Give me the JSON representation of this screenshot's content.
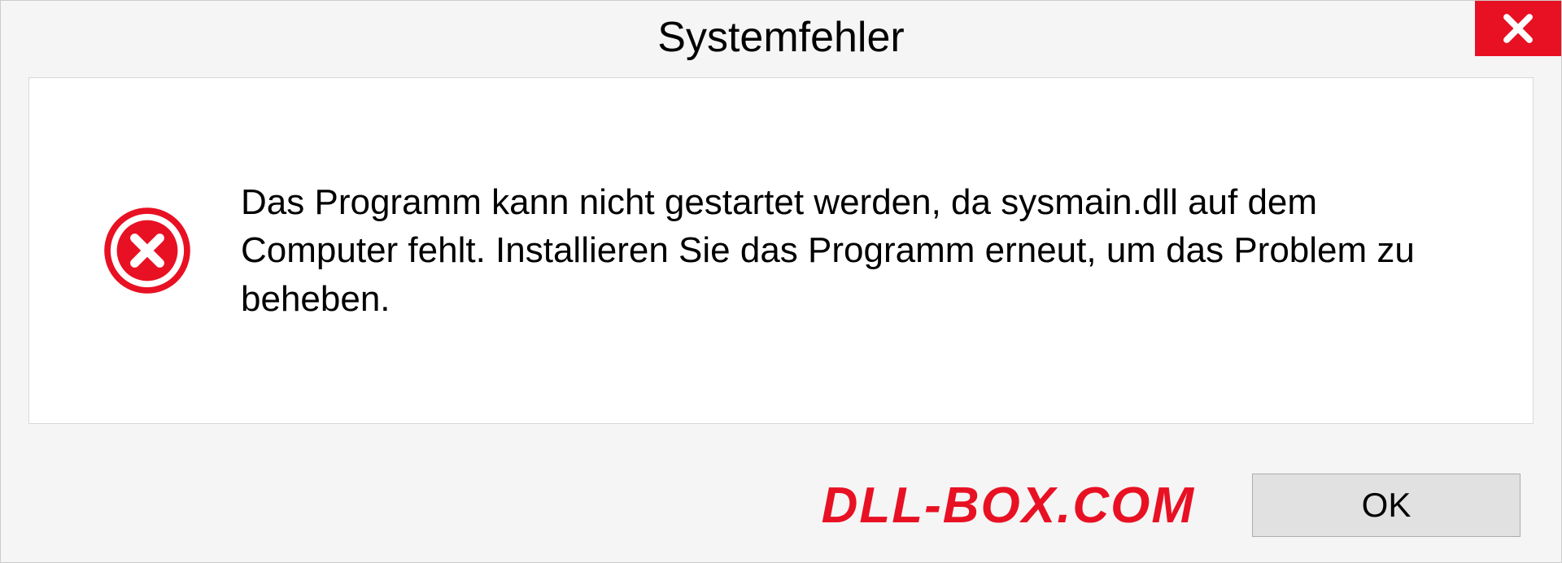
{
  "titlebar": {
    "title": "Systemfehler"
  },
  "content": {
    "message": "Das Programm kann nicht gestartet werden, da sysmain.dll auf dem Computer fehlt. Installieren Sie das Programm erneut, um das Problem zu beheben."
  },
  "footer": {
    "watermark": "DLL-BOX.COM",
    "ok_label": "OK"
  }
}
